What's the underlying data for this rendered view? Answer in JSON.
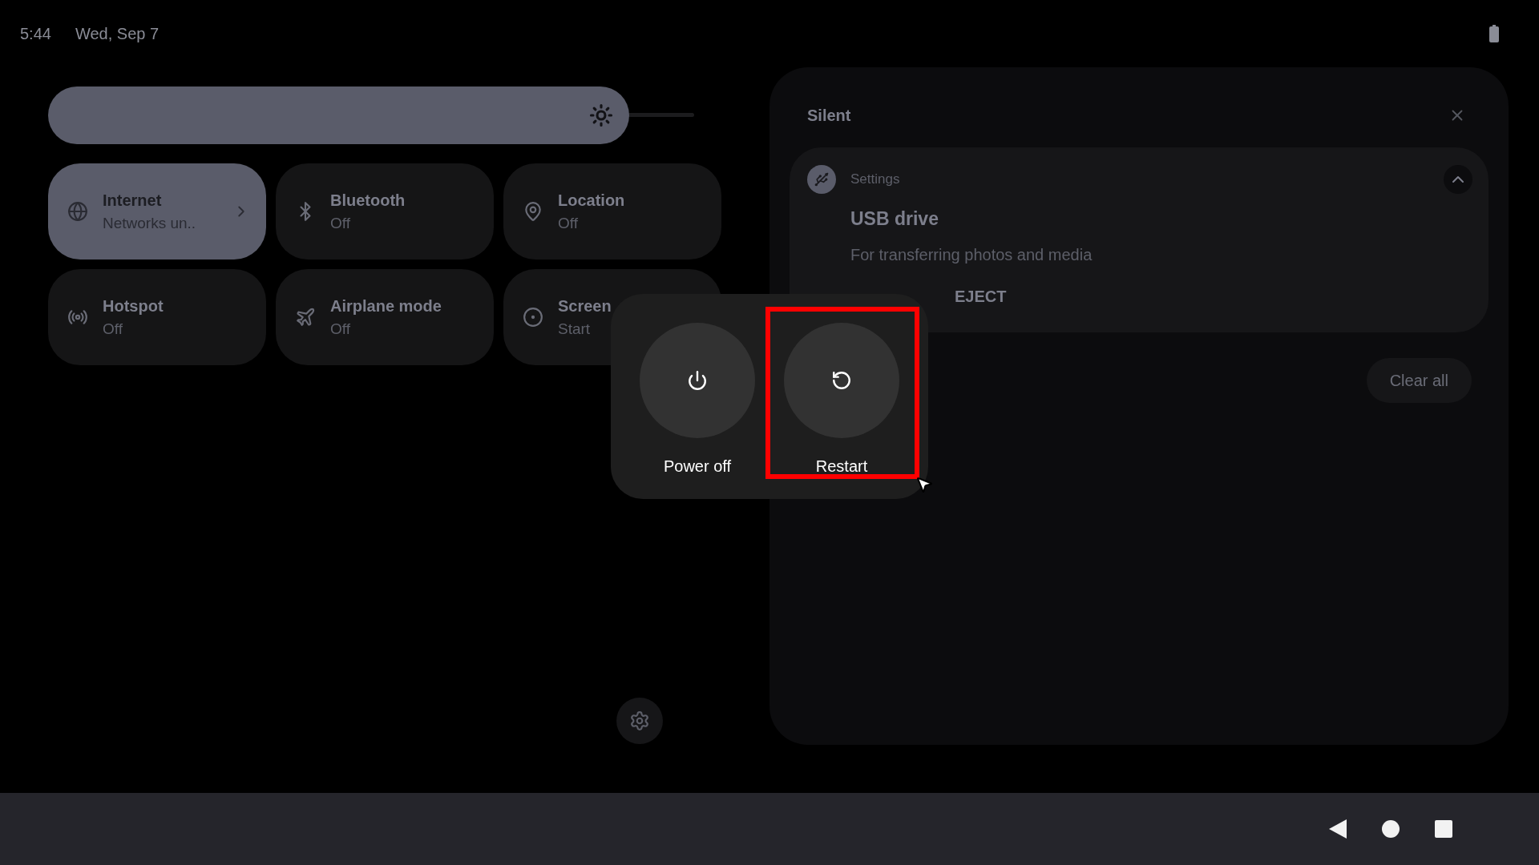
{
  "status_bar": {
    "time": "5:44",
    "date": "Wed, Sep 7"
  },
  "brightness": {
    "level": 0.9
  },
  "tiles": [
    {
      "kind": "internet",
      "title": "Internet",
      "subtitle": "Networks un..",
      "on": true,
      "chevron": true
    },
    {
      "kind": "bluetooth",
      "title": "Bluetooth",
      "subtitle": "Off",
      "on": false,
      "chevron": false
    },
    {
      "kind": "location",
      "title": "Location",
      "subtitle": "Off",
      "on": false,
      "chevron": false
    },
    {
      "kind": "hotspot",
      "title": "Hotspot",
      "subtitle": "Off",
      "on": false,
      "chevron": false
    },
    {
      "kind": "airplane",
      "title": "Airplane mode",
      "subtitle": "Off",
      "on": false,
      "chevron": false
    },
    {
      "kind": "record",
      "title": "Screen",
      "subtitle": "Start",
      "on": false,
      "chevron": false
    }
  ],
  "notifications": {
    "header": "Silent",
    "clear_all": "Clear all",
    "items": [
      {
        "app": "Settings",
        "title": "USB drive",
        "text": "For transferring photos and media",
        "expanded": true,
        "actions": [
          "EJECT"
        ]
      }
    ]
  },
  "power_menu": {
    "actions": [
      {
        "kind": "power",
        "label": "Power off",
        "highlighted": false
      },
      {
        "kind": "restart",
        "label": "Restart",
        "highlighted": true
      }
    ]
  }
}
